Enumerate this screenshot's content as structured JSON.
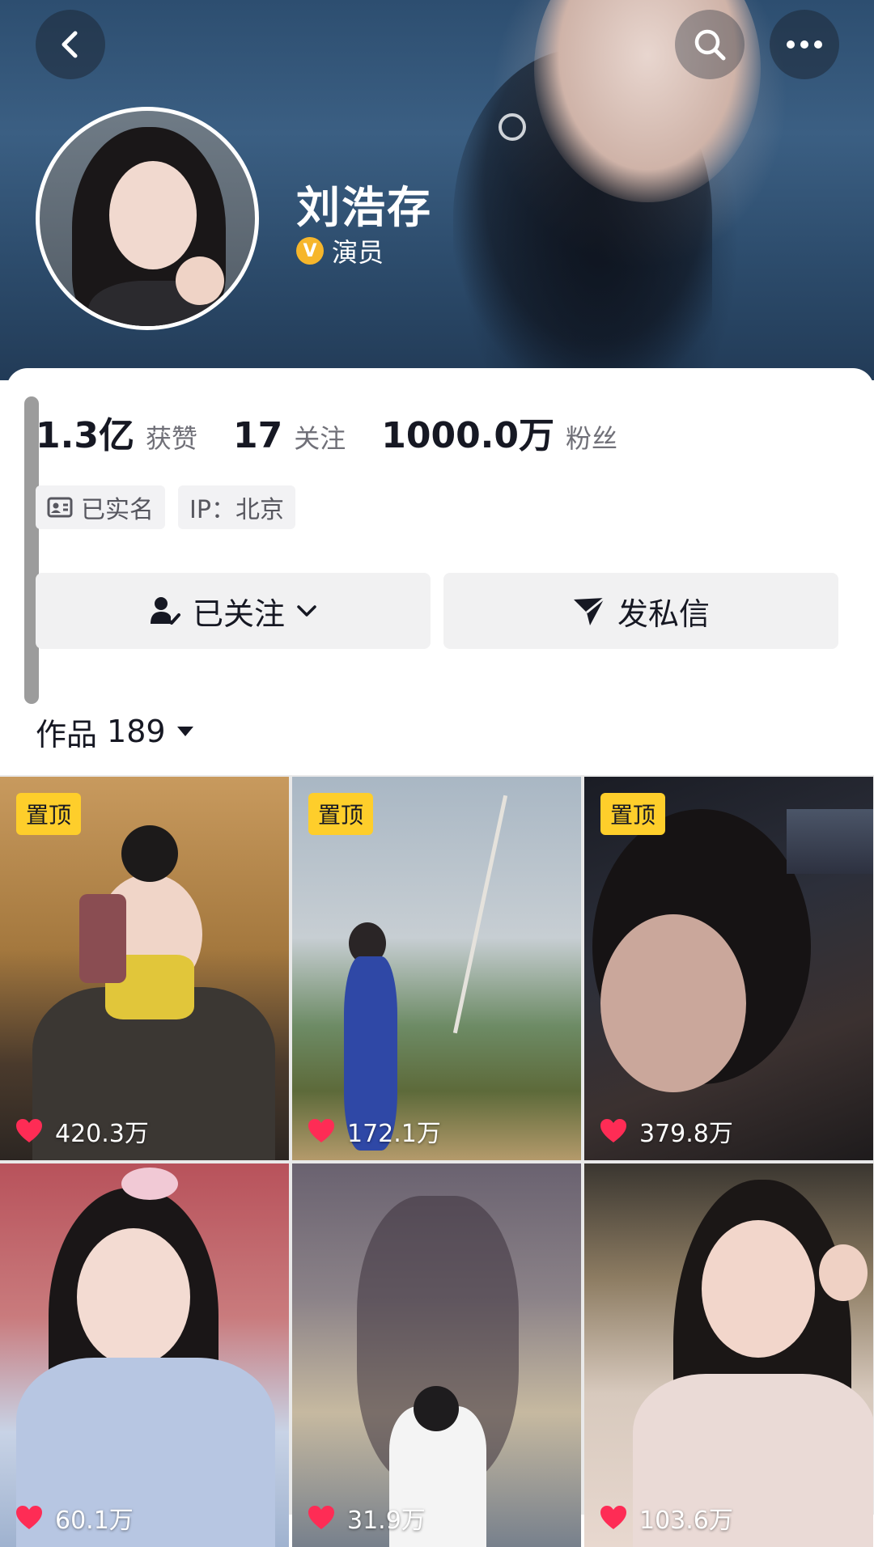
{
  "profile": {
    "name": "刘浩存",
    "verified_title": "演员",
    "verified_badge_letter": "V"
  },
  "stats": {
    "likes": {
      "value": "1.3亿",
      "label": "获赞"
    },
    "following": {
      "value": "17",
      "label": "关注"
    },
    "followers": {
      "value": "1000.0万",
      "label": "粉丝"
    }
  },
  "tags": {
    "real_name": "已实名",
    "ip": "IP：北京"
  },
  "actions": {
    "followed": "已关注",
    "message": "发私信"
  },
  "works": {
    "label": "作品",
    "count": "189"
  },
  "pinned_label": "置顶",
  "videos": [
    {
      "likes": "420.3万",
      "pinned": true
    },
    {
      "likes": "172.1万",
      "pinned": true
    },
    {
      "likes": "379.8万",
      "pinned": true
    },
    {
      "likes": "60.1万",
      "pinned": false
    },
    {
      "likes": "31.9万",
      "pinned": false
    },
    {
      "likes": "103.6万",
      "pinned": false
    }
  ],
  "colors": {
    "pinned_badge": "#fece2b",
    "heart": "#fe2c55",
    "verify_badge": "#f6b62b"
  },
  "icons": [
    "back-icon",
    "search-icon",
    "more-icon",
    "verified-icon",
    "id-card-icon",
    "user-check-icon",
    "chevron-down-icon",
    "send-icon",
    "caret-down-icon",
    "heart-icon"
  ]
}
